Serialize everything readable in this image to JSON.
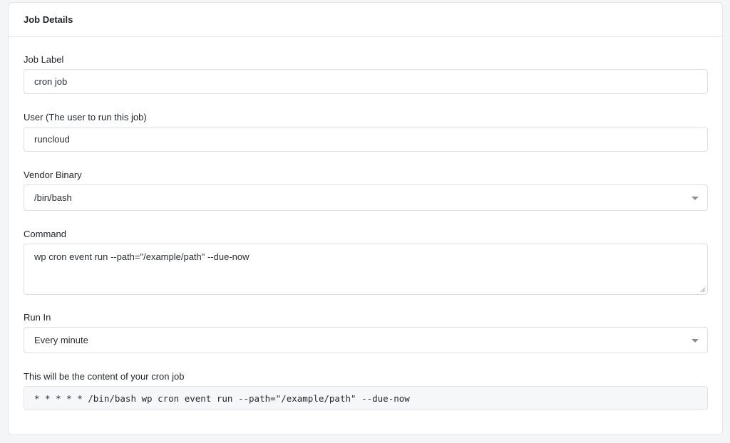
{
  "card": {
    "title": "Job Details"
  },
  "form": {
    "job_label": {
      "label": "Job Label",
      "value": "cron job"
    },
    "user": {
      "label": "User (The user to run this job)",
      "value": "runcloud"
    },
    "vendor_binary": {
      "label": "Vendor Binary",
      "selected": "/bin/bash",
      "icon": "chevron-down-icon"
    },
    "command": {
      "label": "Command",
      "value": "wp cron event run --path=\"/example/path\" --due-now",
      "icon": "resize-grip-icon"
    },
    "run_in": {
      "label": "Run In",
      "selected": "Every minute",
      "icon": "chevron-down-icon"
    },
    "preview": {
      "label": "This will be the content of your cron job",
      "value": "* * * * * /bin/bash wp cron event run --path=\"/example/path\" --due-now"
    }
  },
  "colors": {
    "page_background": "#f4f5f7",
    "card_border": "#e3e5e8",
    "input_border": "#dcdfe3",
    "preview_background": "#f6f7f8",
    "caret": "#8a8f96"
  }
}
